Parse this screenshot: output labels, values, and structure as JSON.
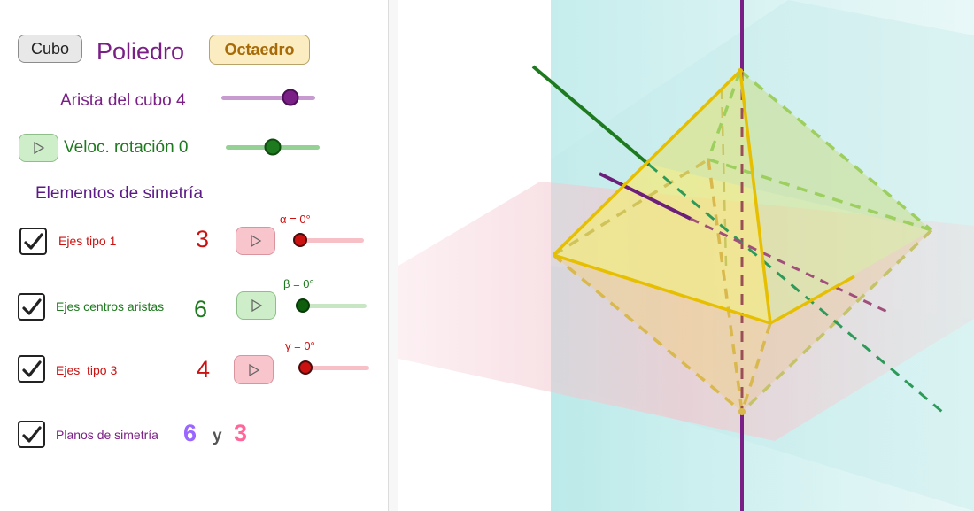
{
  "panel": {
    "cubo_button": "Cubo",
    "title": "Poliedro",
    "octaedro_button": "Octaedro",
    "arista_label": "Arista del cubo 4",
    "arista_slider_level": 0.78,
    "veloc_label": "Veloc. rotación 0",
    "veloc_slider_level": 0.5,
    "section_heading": "Elementos de simetría",
    "rows": [
      {
        "label": "Ejes tipo 1",
        "count": "3",
        "angle": "α = 0°",
        "slider_level": 0.0,
        "checked": true
      },
      {
        "label": "Ejes centros aristas",
        "count": "6",
        "angle": "β = 0°",
        "slider_level": 0.0,
        "checked": true
      },
      {
        "label": "Ejes  tipo 3",
        "count": "4",
        "angle": "γ = 0°",
        "slider_level": 0.0,
        "checked": true
      },
      {
        "label": "Planos de simetría",
        "count_a": "6",
        "joiner": "y",
        "count_b": "3",
        "checked": true
      }
    ]
  },
  "icons": {
    "play": "play-icon",
    "check": "check-icon"
  },
  "colors": {
    "purple": "#7a1f86",
    "purple_track": "#c79ad0",
    "green": "#1e7a1e",
    "green_track": "#95d095",
    "red": "#cc1111",
    "red_track": "#f6c0c6",
    "red_button": "#f9c5cc",
    "green_button": "#cdeec8",
    "violet_count": "#9966ff",
    "pink_count": "#ff6699",
    "gold": "#e6bf00",
    "cyan_plane": "#7fd6d6",
    "pink_plane": "#f4c6cf"
  }
}
